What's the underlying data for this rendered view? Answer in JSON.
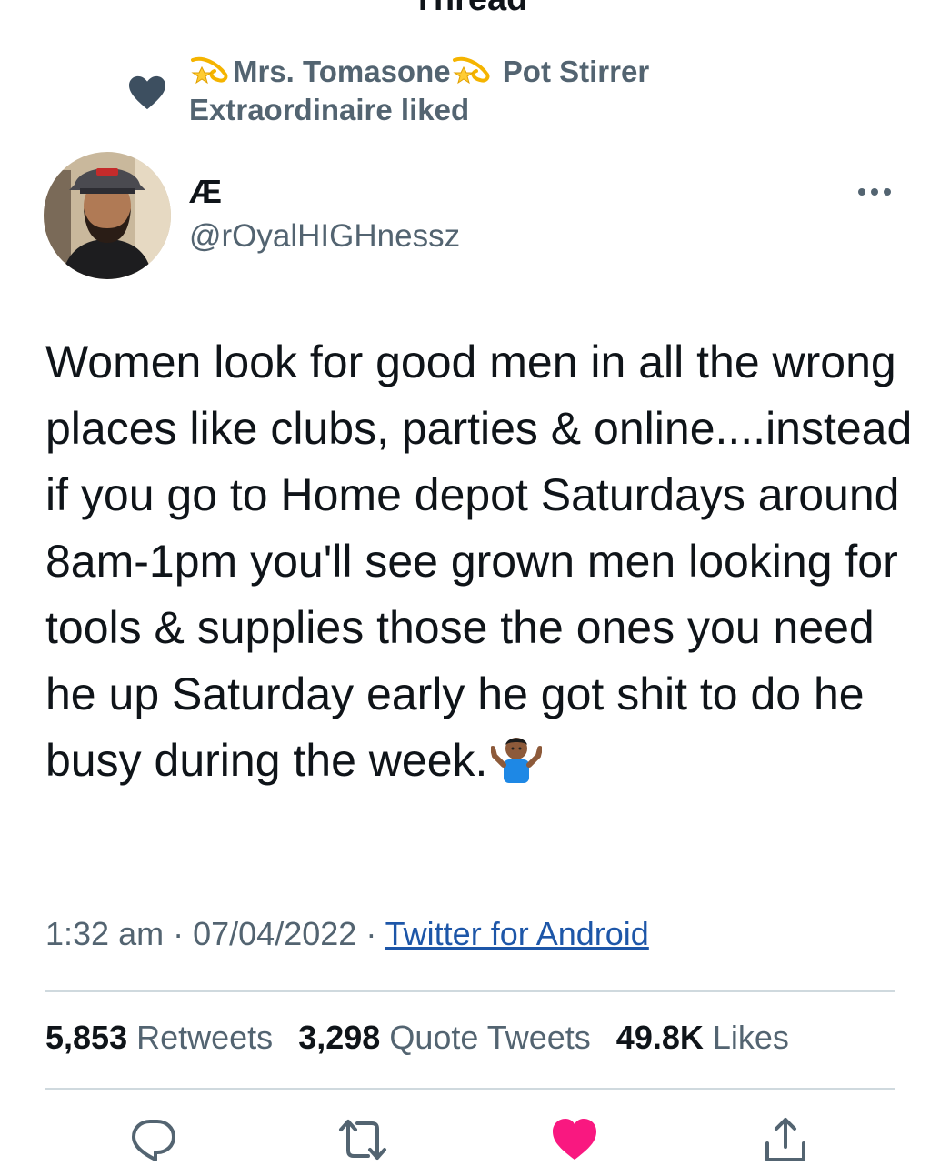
{
  "header": {
    "title": "Thread",
    "back_icon": "back-arrow-icon"
  },
  "social_context": {
    "icon": "heart-icon",
    "name_part1": "Mrs. Tomasone",
    "name_part2": "Pot Stirrer",
    "name_part3": "Extraordinaire liked",
    "emoji": "dizzy-icon",
    "color": "#536471"
  },
  "tweet": {
    "author": {
      "display_name": "Æ",
      "handle": "@rOyalHIGHnessz"
    },
    "more_icon": "more-dots-icon",
    "text": "Women look for good men in all the wrong places like clubs, parties & online....instead if you go to Home depot Saturdays around 8am-1pm you'll see grown men looking for tools & supplies those the ones you need he up Saturday early he got shit to do he busy during the week.",
    "text_emoji": "shrug-icon",
    "time": "1:32 am",
    "date": "07/04/2022",
    "separator": "·",
    "source": "Twitter for Android"
  },
  "stats": {
    "retweets_count": "5,853",
    "retweets_label": "Retweets",
    "quotes_count": "3,298",
    "quotes_label": "Quote Tweets",
    "likes_count": "49.8K",
    "likes_label": "Likes"
  },
  "actions": {
    "reply_icon": "reply-icon",
    "retweet_icon": "retweet-icon",
    "like_icon": "heart-filled-icon",
    "share_icon": "share-icon",
    "like_color": "#f91880",
    "icon_color": "#536471"
  }
}
